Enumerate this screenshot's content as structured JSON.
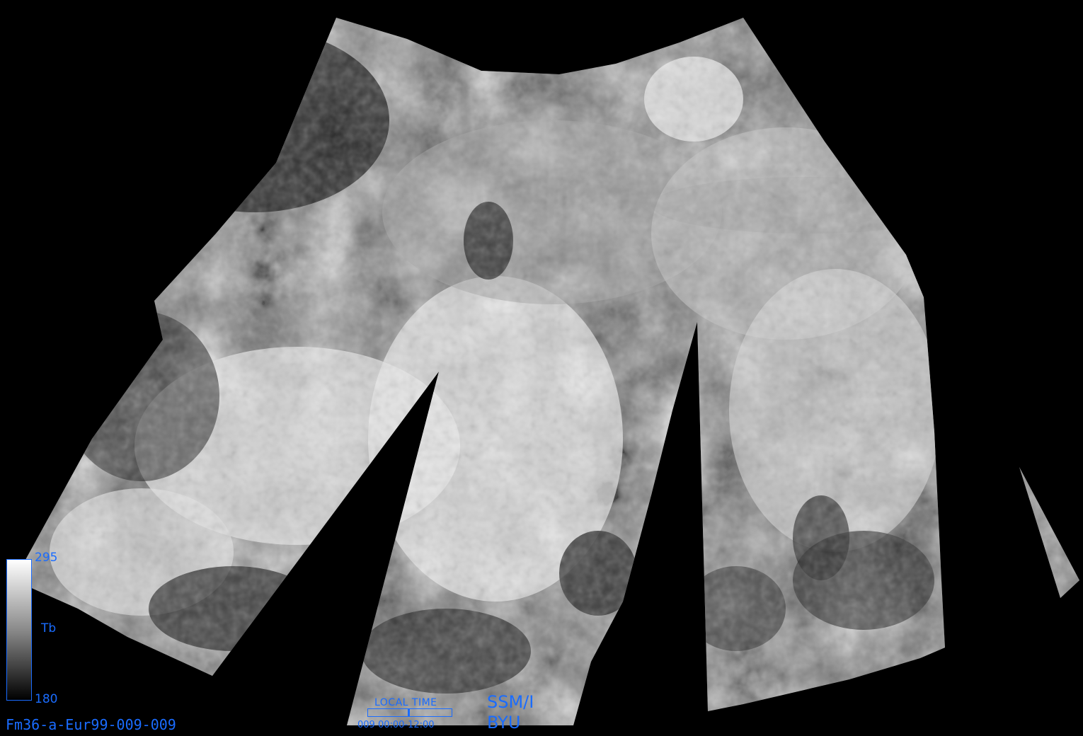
{
  "image": {
    "id_label": "Fm36-a-Eur99-009-009",
    "sensor": "SSM/I",
    "organization": "BYU"
  },
  "colorbar": {
    "title": "Tb",
    "max_label": "295",
    "min_label": "180",
    "max_color": "#ffffff",
    "min_color": "#000000"
  },
  "time_indicator": {
    "title": "LOCAL TIME",
    "range_label": "009 00:00-12:00",
    "fraction": 0.5
  },
  "colors": {
    "background": "#000000",
    "annotation": "#1a6cff"
  }
}
